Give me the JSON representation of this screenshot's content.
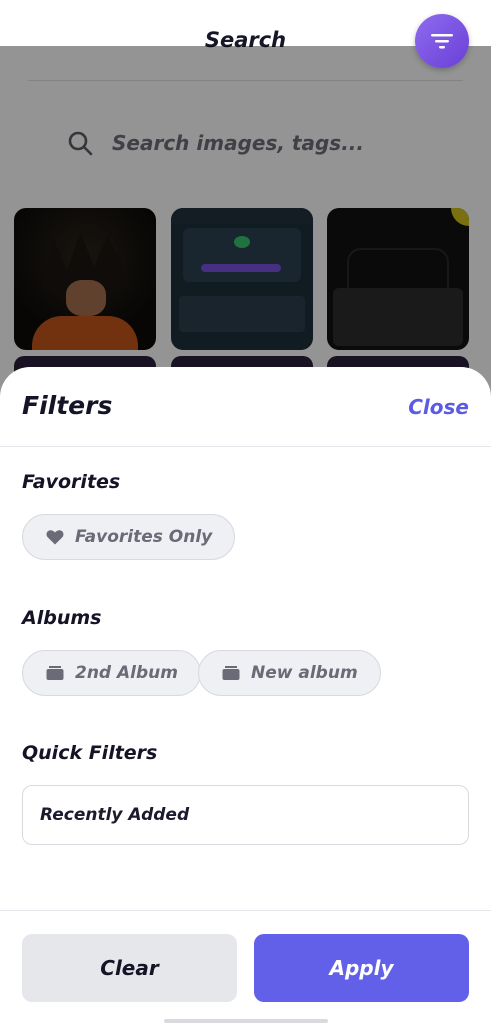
{
  "header": {
    "title": "Search"
  },
  "search": {
    "placeholder": "Search images, tags..."
  },
  "filters_sheet": {
    "title": "Filters",
    "close_label": "Close",
    "sections": {
      "favorites": {
        "title": "Favorites",
        "chip_label": "Favorites Only",
        "chip_icon": "heart-icon"
      },
      "albums": {
        "title": "Albums",
        "chips": [
          {
            "label": "2nd Album",
            "icon": "folder-icon"
          },
          {
            "label": "New album",
            "icon": "folder-icon"
          }
        ]
      },
      "quick_filters": {
        "title": "Quick Filters",
        "selected": "Recently Added"
      }
    },
    "buttons": {
      "clear": "Clear",
      "apply": "Apply"
    }
  },
  "colors": {
    "accent": "#6260e8",
    "close_link": "#5b5be6",
    "fab_gradient_start": "#8e6cf0",
    "fab_gradient_end": "#6a3fd6"
  }
}
